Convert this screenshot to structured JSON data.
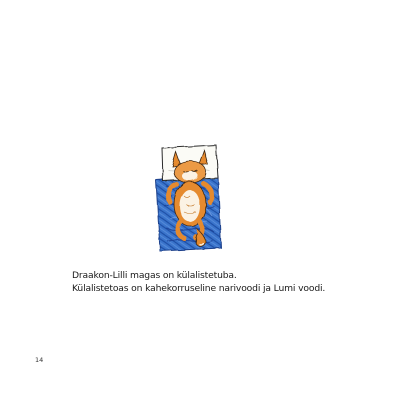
{
  "story": {
    "lines": [
      "Draakon-Lilli magas on külalistetuba.",
      "Külalistetoas on kahekorruseline narivoodi ja Lumi voodi."
    ]
  },
  "page_number": "14",
  "illustration": {
    "subject": "fox-sleeping-on-blanket",
    "colors": {
      "blanket": "#2f6bc4",
      "pillow": "#fbfbf6",
      "fox": "#e58a2e"
    }
  }
}
